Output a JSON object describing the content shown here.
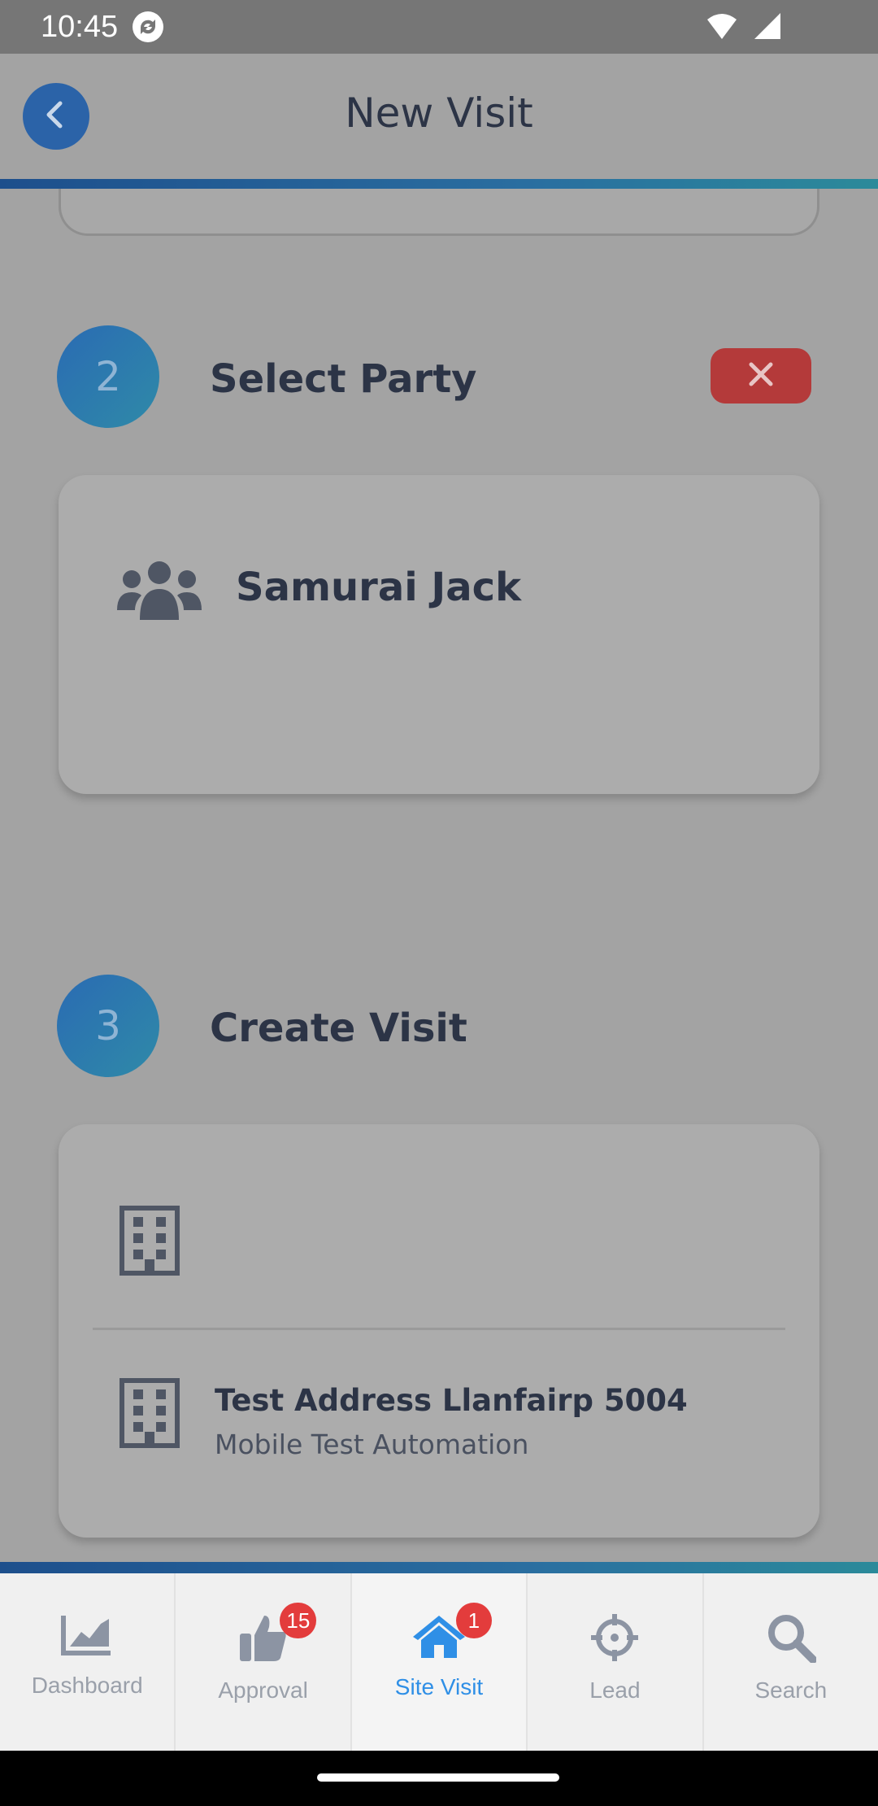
{
  "status_bar": {
    "time": "10:45"
  },
  "header": {
    "title": "New Visit",
    "back_icon": "chevron-left-icon"
  },
  "steps": [
    {
      "number": "2",
      "title": "Select Party"
    },
    {
      "number": "3",
      "title": "Create Visit"
    }
  ],
  "party": {
    "name": "Samurai Jack",
    "icon": "users-icon"
  },
  "visit": {
    "row1_icon": "building-icon",
    "address_title": "Test Address Llanfairp 5004",
    "address_subtitle": "Mobile Test Automation"
  },
  "nav": [
    {
      "label": "Dashboard",
      "icon": "chart-icon",
      "badge": ""
    },
    {
      "label": "Approval",
      "icon": "thumbs-up-icon",
      "badge": "15"
    },
    {
      "label": "Site Visit",
      "icon": "home-icon",
      "badge": "1",
      "active": true
    },
    {
      "label": "Lead",
      "icon": "crosshair-icon",
      "badge": ""
    },
    {
      "label": "Search",
      "icon": "search-icon",
      "badge": ""
    }
  ],
  "colors": {
    "accent": "#2f8fe6",
    "danger": "#b43a3a",
    "badge": "#e33c3c"
  }
}
